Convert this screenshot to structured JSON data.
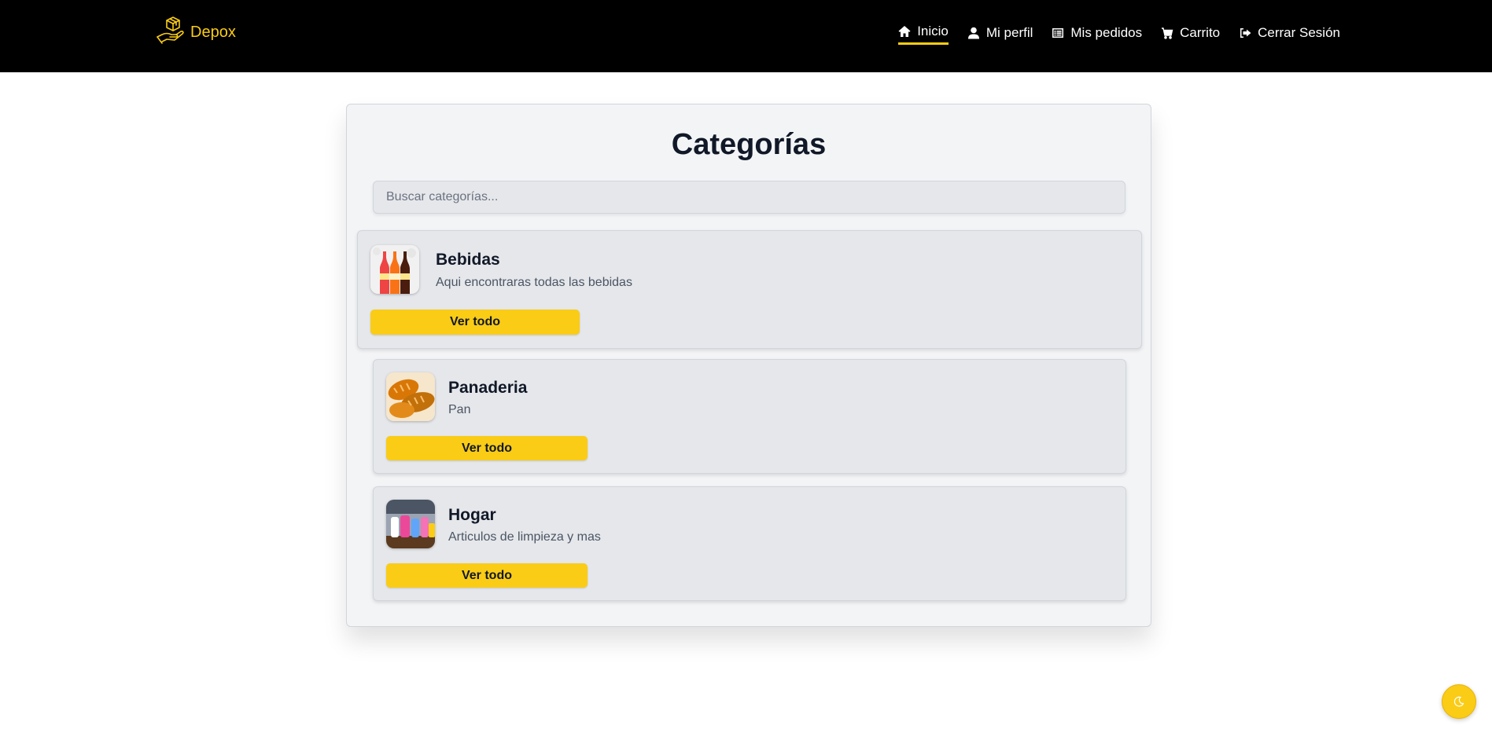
{
  "brand": {
    "name": "Depox",
    "logo_icon": "hand-box-icon"
  },
  "nav": [
    {
      "label": "Inicio",
      "icon": "home-icon",
      "active": true
    },
    {
      "label": "Mi perfil",
      "icon": "user-icon",
      "active": false
    },
    {
      "label": "Mis pedidos",
      "icon": "list-icon",
      "active": false
    },
    {
      "label": "Carrito",
      "icon": "cart-icon",
      "active": false
    },
    {
      "label": "Cerrar Sesión",
      "icon": "logout-icon",
      "active": false
    }
  ],
  "page": {
    "title": "Categorías",
    "search_placeholder": "Buscar categorías..."
  },
  "categories": [
    {
      "name": "Bebidas",
      "description": "Aqui encontraras todas las bebidas",
      "button": "Ver todo",
      "image": "drinks-image"
    },
    {
      "name": "Panaderia",
      "description": "Pan",
      "button": "Ver todo",
      "image": "bread-image"
    },
    {
      "name": "Hogar",
      "description": "Articulos de limpieza y mas",
      "button": "Ver todo",
      "image": "home-products-image"
    }
  ],
  "theme_toggle": {
    "icon": "moon-icon"
  },
  "colors": {
    "accent": "#facc15",
    "navbar": "#000000",
    "panel": "#f3f4f6",
    "card": "#e5e7eb"
  }
}
